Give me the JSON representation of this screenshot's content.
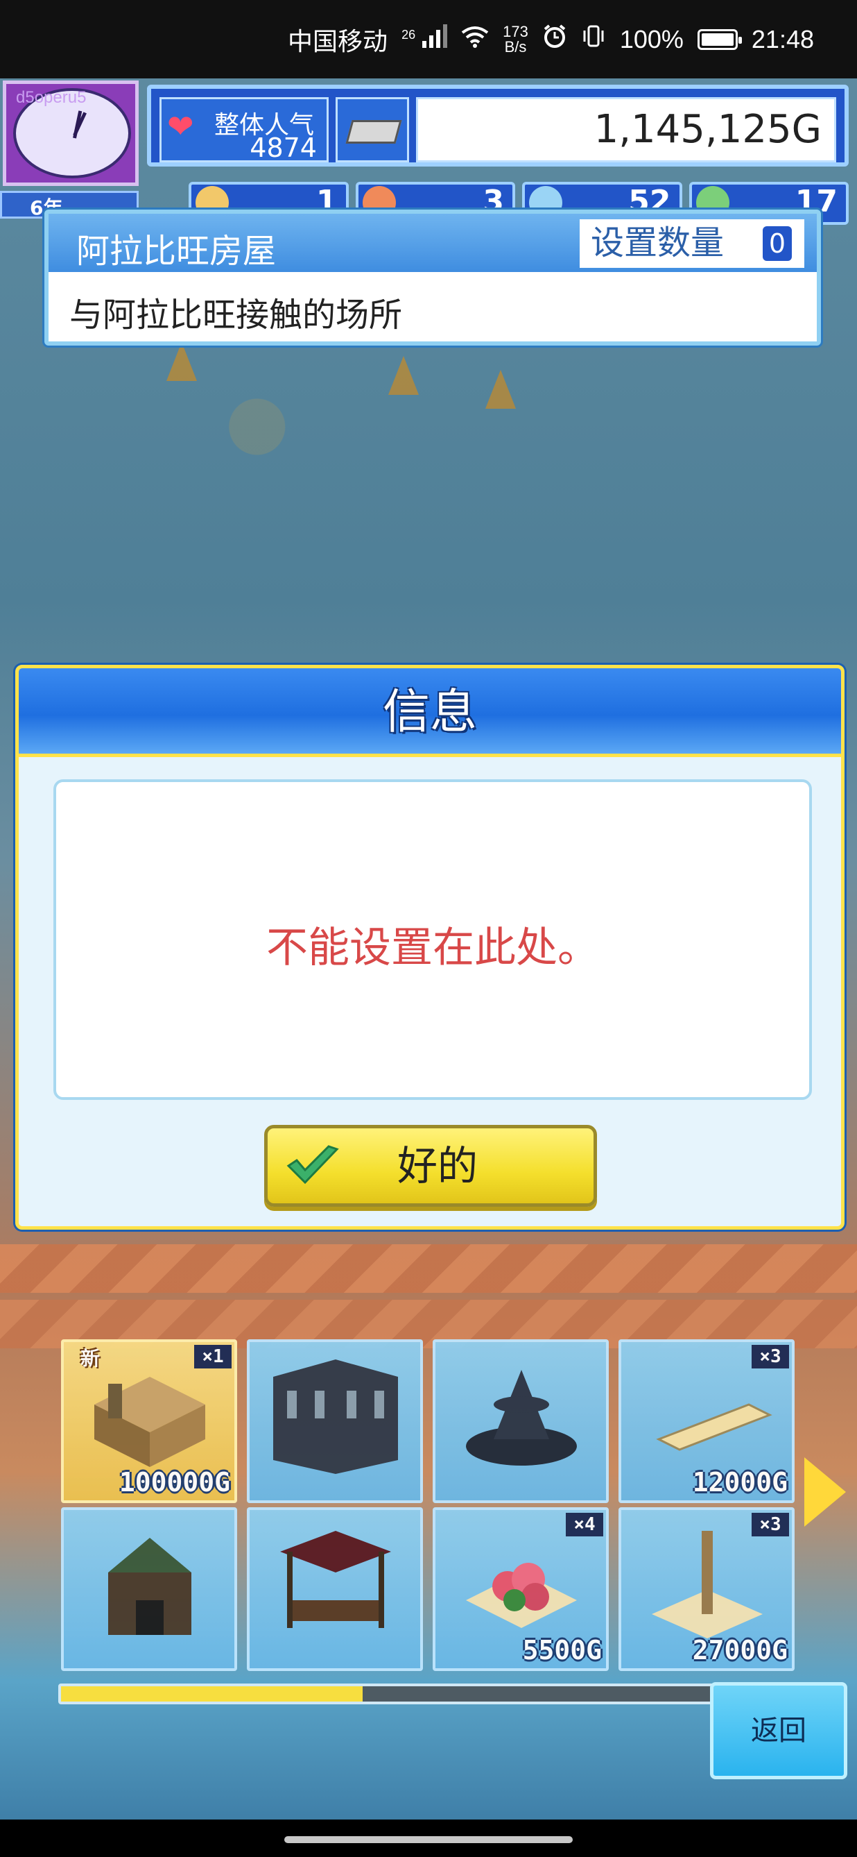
{
  "status_bar": {
    "carrier": "中国移动",
    "network": "26",
    "speed_value": "173",
    "speed_unit": "B/s",
    "battery": "100%",
    "time": "21:48"
  },
  "hud": {
    "clock_user": "d5operu5",
    "date": "6年",
    "popularity_label": "整体人气",
    "popularity_value": "4874",
    "money": "1,145,125G",
    "stats": [
      "1",
      "3",
      "52",
      "17"
    ]
  },
  "item_info": {
    "name": "阿拉比旺房屋",
    "place_count_label": "设置数量",
    "place_count_value": "0",
    "description": "与阿拉比旺接触的场所"
  },
  "dialog": {
    "title": "信息",
    "message": "不能设置在此处。",
    "ok_label": "好的"
  },
  "shelf": {
    "items": [
      {
        "tag": "新",
        "qty": "×1",
        "price": "100000G"
      },
      {
        "tag": "",
        "qty": "",
        "price": ""
      },
      {
        "tag": "",
        "qty": "",
        "price": ""
      },
      {
        "tag": "",
        "qty": "×3",
        "price": "12000G"
      },
      {
        "tag": "",
        "qty": "",
        "price": ""
      },
      {
        "tag": "",
        "qty": "",
        "price": ""
      },
      {
        "tag": "",
        "qty": "×4",
        "price": "5500G"
      },
      {
        "tag": "",
        "qty": "×3",
        "price": "27000G"
      }
    ],
    "scroll_progress": 0.41
  },
  "back_label": "返回",
  "colors": {
    "accent_blue": "#2255c8",
    "dialog_border": "#ffe24a",
    "error_text": "#d84848",
    "ok_button": "#f4df2c"
  }
}
